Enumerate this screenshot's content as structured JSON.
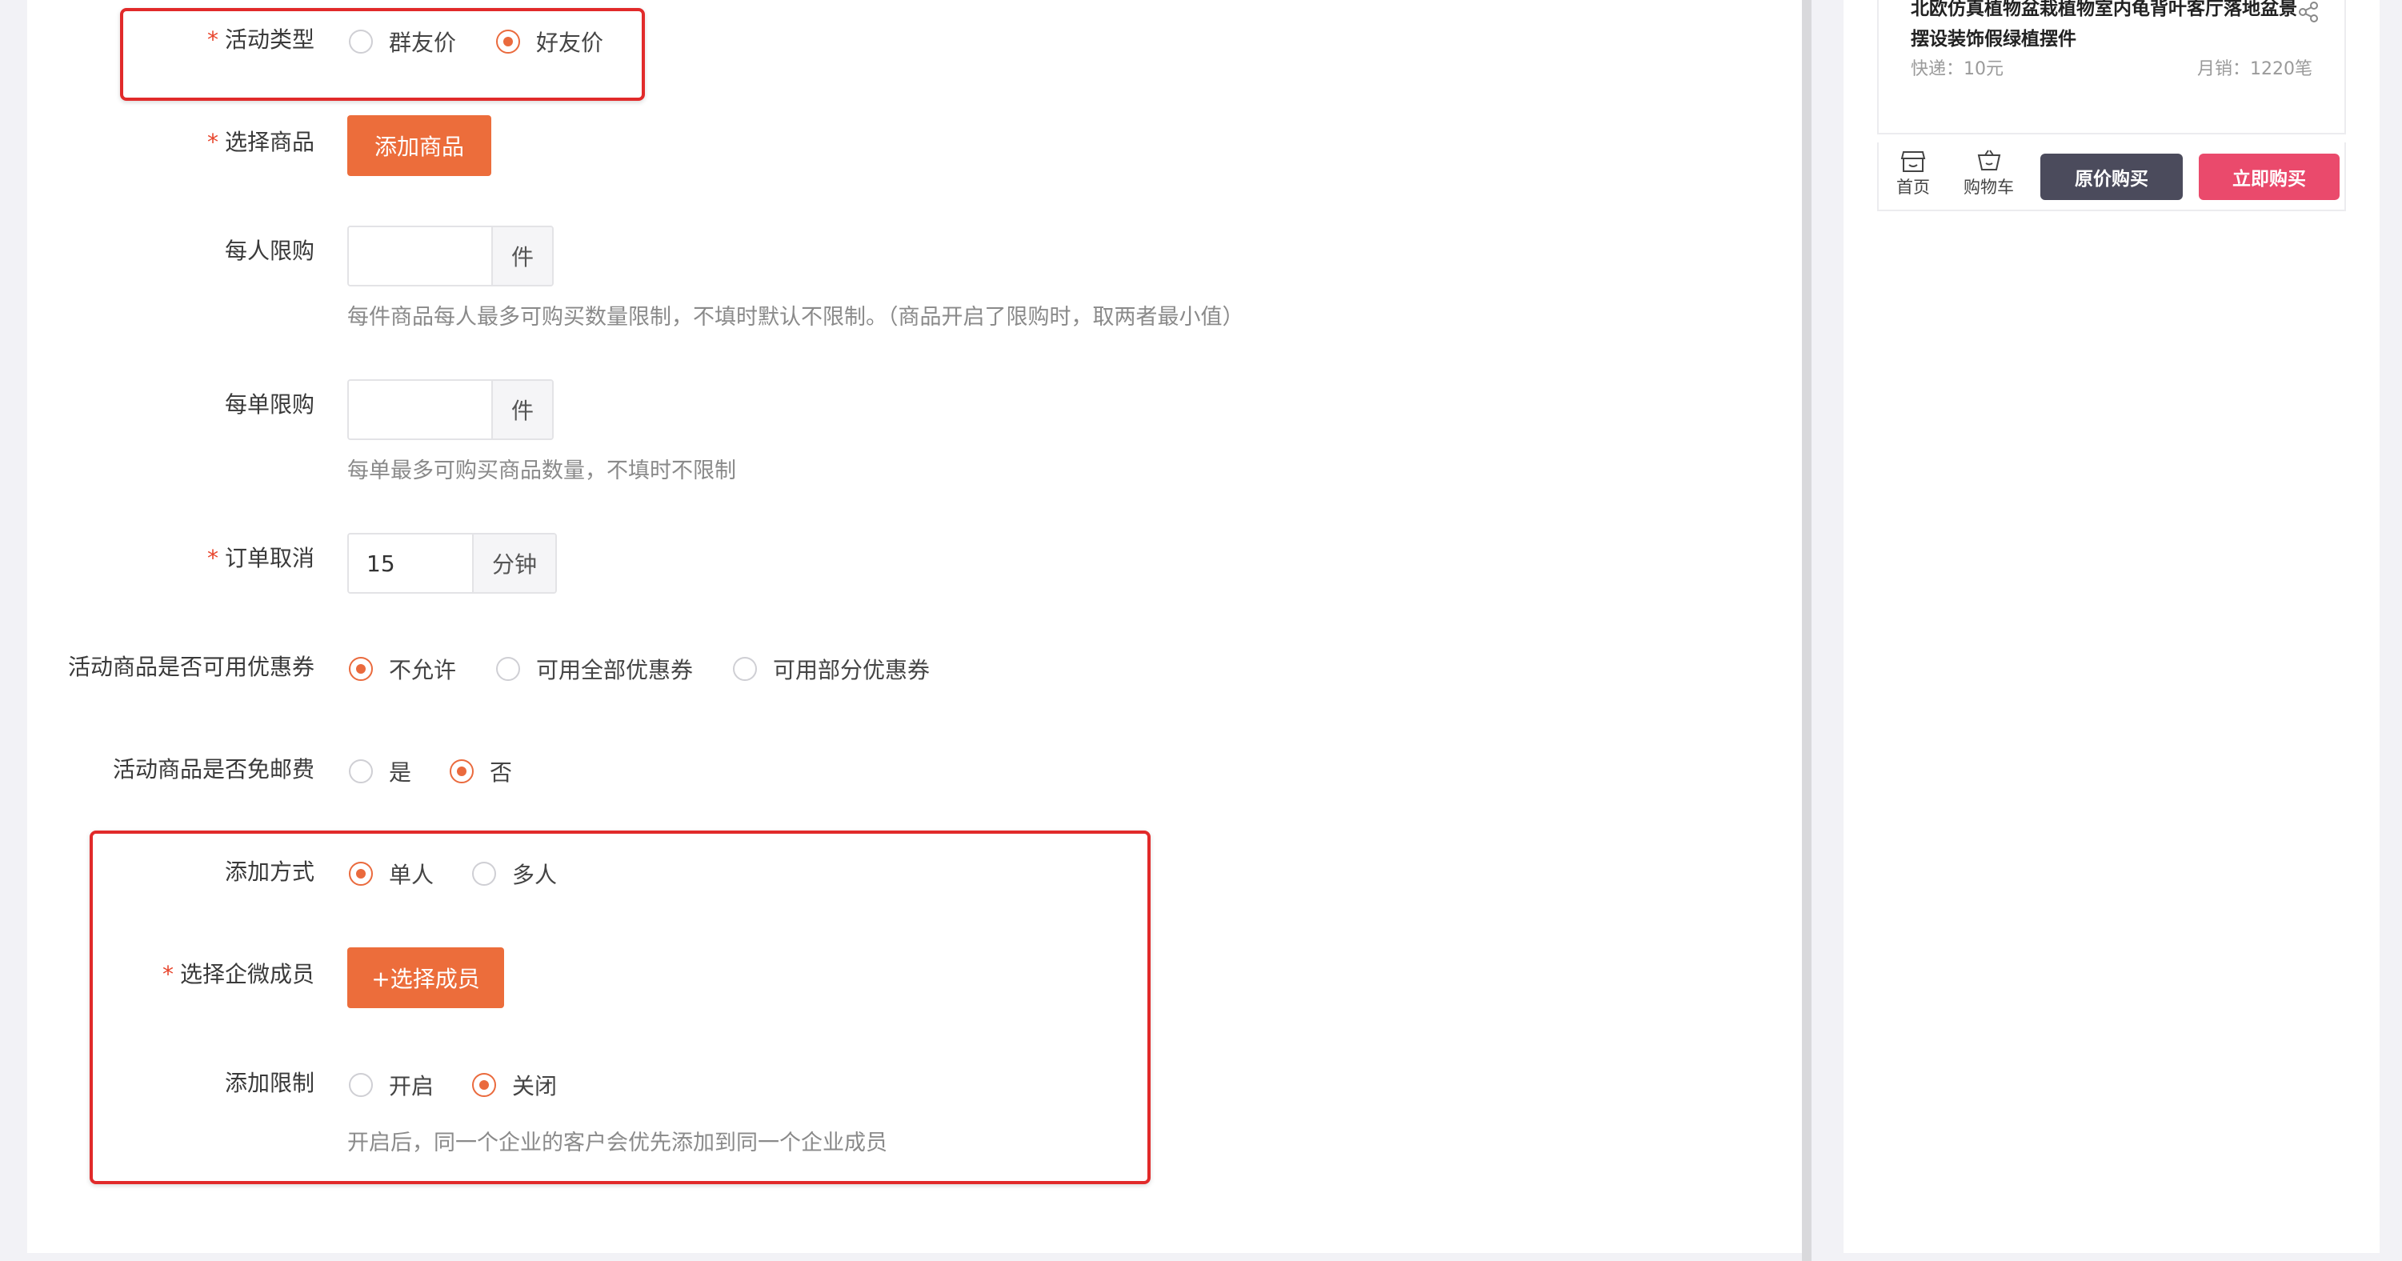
{
  "form": {
    "activity_type": {
      "label": "活动类型",
      "required": "*",
      "options": [
        "群友价",
        "好友价"
      ],
      "selected": "好友价"
    },
    "select_goods": {
      "label": "选择商品",
      "required": "*",
      "button": "添加商品"
    },
    "per_person_limit": {
      "label": "每人限购",
      "value": "",
      "suffix": "件",
      "hint": "每件商品每人最多可购买数量限制，不填时默认不限制。（商品开启了限购时，取两者最小值）"
    },
    "per_order_limit": {
      "label": "每单限购",
      "value": "",
      "suffix": "件",
      "hint": "每单最多可购买商品数量，不填时不限制"
    },
    "order_cancel": {
      "label": "订单取消",
      "required": "*",
      "value": "15",
      "suffix": "分钟"
    },
    "coupon_usage": {
      "label": "活动商品是否可用优惠券",
      "options": [
        "不允许",
        "可用全部优惠券",
        "可用部分优惠券"
      ],
      "selected": "不允许"
    },
    "free_shipping": {
      "label": "活动商品是否免邮费",
      "options": [
        "是",
        "否"
      ],
      "selected": "否"
    },
    "add_method": {
      "label": "添加方式",
      "options": [
        "单人",
        "多人"
      ],
      "selected": "单人"
    },
    "select_member": {
      "label": "选择企微成员",
      "required": "*",
      "button": "+选择成员"
    },
    "add_limit": {
      "label": "添加限制",
      "options": [
        "开启",
        "关闭"
      ],
      "selected": "关闭",
      "hint": "开启后，同一个企业的客户会优先添加到同一个企业成员"
    }
  },
  "preview": {
    "product_title": "北欧仿真植物盆栽植物室内龟背叶客厅落地盆景摆设装饰假绿植摆件",
    "shipping": "快递：10元",
    "monthly_sales": "月销：1220笔",
    "nav_home": "首页",
    "nav_cart": "购物车",
    "btn_original": "原价购买",
    "btn_buy_now": "立即购买",
    "icons": [
      "share-icon",
      "store-icon",
      "basket-icon"
    ]
  },
  "colors": {
    "accent": "#ec6d3b",
    "highlight_box": "#e12a2a",
    "buy_now": "#ea4a6c",
    "original_price": "#4b4b5c"
  }
}
